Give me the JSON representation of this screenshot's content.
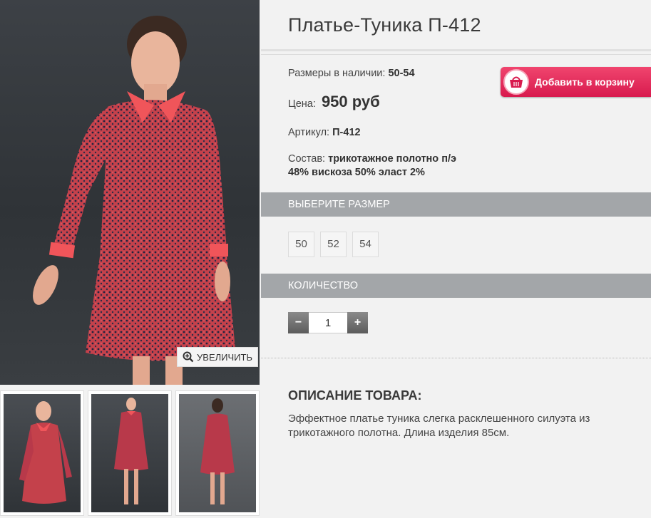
{
  "product": {
    "title": "Платье-Туника П-412",
    "sizes_label": "Размеры в наличии:",
    "sizes_value": "50-54",
    "price_label": "Цена:",
    "price_value": "950 руб",
    "article_label": "Артикул:",
    "article_value": "П-412",
    "composition_label": "Состав:",
    "composition_value_1": "трикотажное полотно п/э",
    "composition_value_2": "48% вискоза 50% эласт 2%"
  },
  "cart_button": {
    "label": "Добавить в корзину",
    "icon": "basket-icon"
  },
  "zoom_button": {
    "label": "УВЕЛИЧИТЬ",
    "icon": "magnifier-plus-icon"
  },
  "size_section": {
    "heading": "ВЫБЕРИТЕ РАЗМЕР",
    "options": [
      "50",
      "52",
      "54"
    ]
  },
  "quantity_section": {
    "heading": "КОЛИЧЕСТВО",
    "minus": "−",
    "value": "1",
    "plus": "+"
  },
  "description": {
    "heading": "ОПИСАНИЕ ТОВАРА:",
    "text": "Эффектное платье туника слегка расклешенного силуэта из трикотажного полотна. Длина изделия 85см."
  },
  "colors": {
    "dress_red": "#c8404a",
    "collar_coral": "#f0555a",
    "cart_pink": "#e02a58",
    "section_gray": "#a3a6a9",
    "background": "#f2f2f2"
  }
}
